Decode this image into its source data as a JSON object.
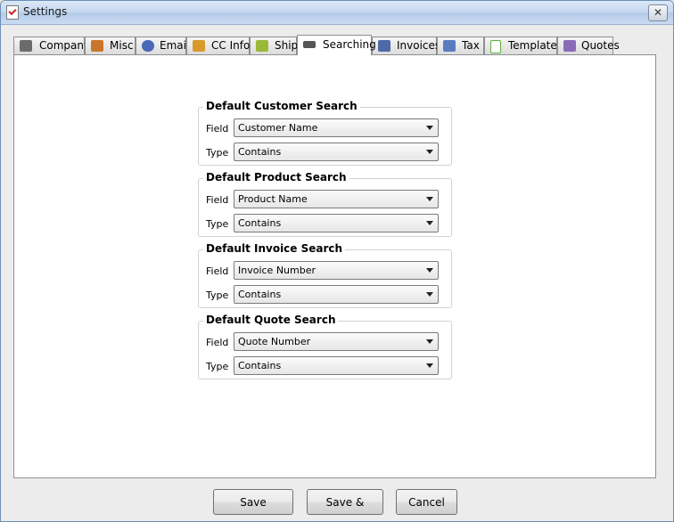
{
  "window": {
    "title": "Settings",
    "close_symbol": "✕"
  },
  "tabs": [
    {
      "label": "Company",
      "icon": "briefcase-icon",
      "color": "#6b6b6b"
    },
    {
      "label": "Misc",
      "icon": "grid-icon",
      "color": "#c9762a"
    },
    {
      "label": "Email",
      "icon": "at-sign-icon",
      "color": "#4a67b8"
    },
    {
      "label": "CC Info",
      "icon": "credit-card-icon",
      "color": "#d89a2a"
    },
    {
      "label": "Ship",
      "icon": "ship-icon",
      "color": "#9ab93a"
    },
    {
      "label": "Searching",
      "icon": "binoculars-icon",
      "color": "#555555",
      "active": true
    },
    {
      "label": "Invoices",
      "icon": "invoice-icon",
      "color": "#4d6aa8"
    },
    {
      "label": "Tax",
      "icon": "percent-icon",
      "color": "#5a7bc0"
    },
    {
      "label": "Templates",
      "icon": "document-icon",
      "color": "#5fae3c"
    },
    {
      "label": "Quotes",
      "icon": "pencil-note-icon",
      "color": "#8a6bb8"
    }
  ],
  "groups": [
    {
      "title": "Default Customer Search",
      "field_label": "Field",
      "field_value": "Customer Name",
      "type_label": "Type",
      "type_value": "Contains"
    },
    {
      "title": "Default Product Search",
      "field_label": "Field",
      "field_value": "Product Name",
      "type_label": "Type",
      "type_value": "Contains"
    },
    {
      "title": "Default Invoice Search",
      "field_label": "Field",
      "field_value": "Invoice Number",
      "type_label": "Type",
      "type_value": "Contains"
    },
    {
      "title": "Default Quote Search",
      "field_label": "Field",
      "field_value": "Quote Number",
      "type_label": "Type",
      "type_value": "Contains"
    }
  ],
  "buttons": {
    "save_settings": "Save Settings",
    "save_close": "Save & Close",
    "cancel": "Cancel"
  }
}
